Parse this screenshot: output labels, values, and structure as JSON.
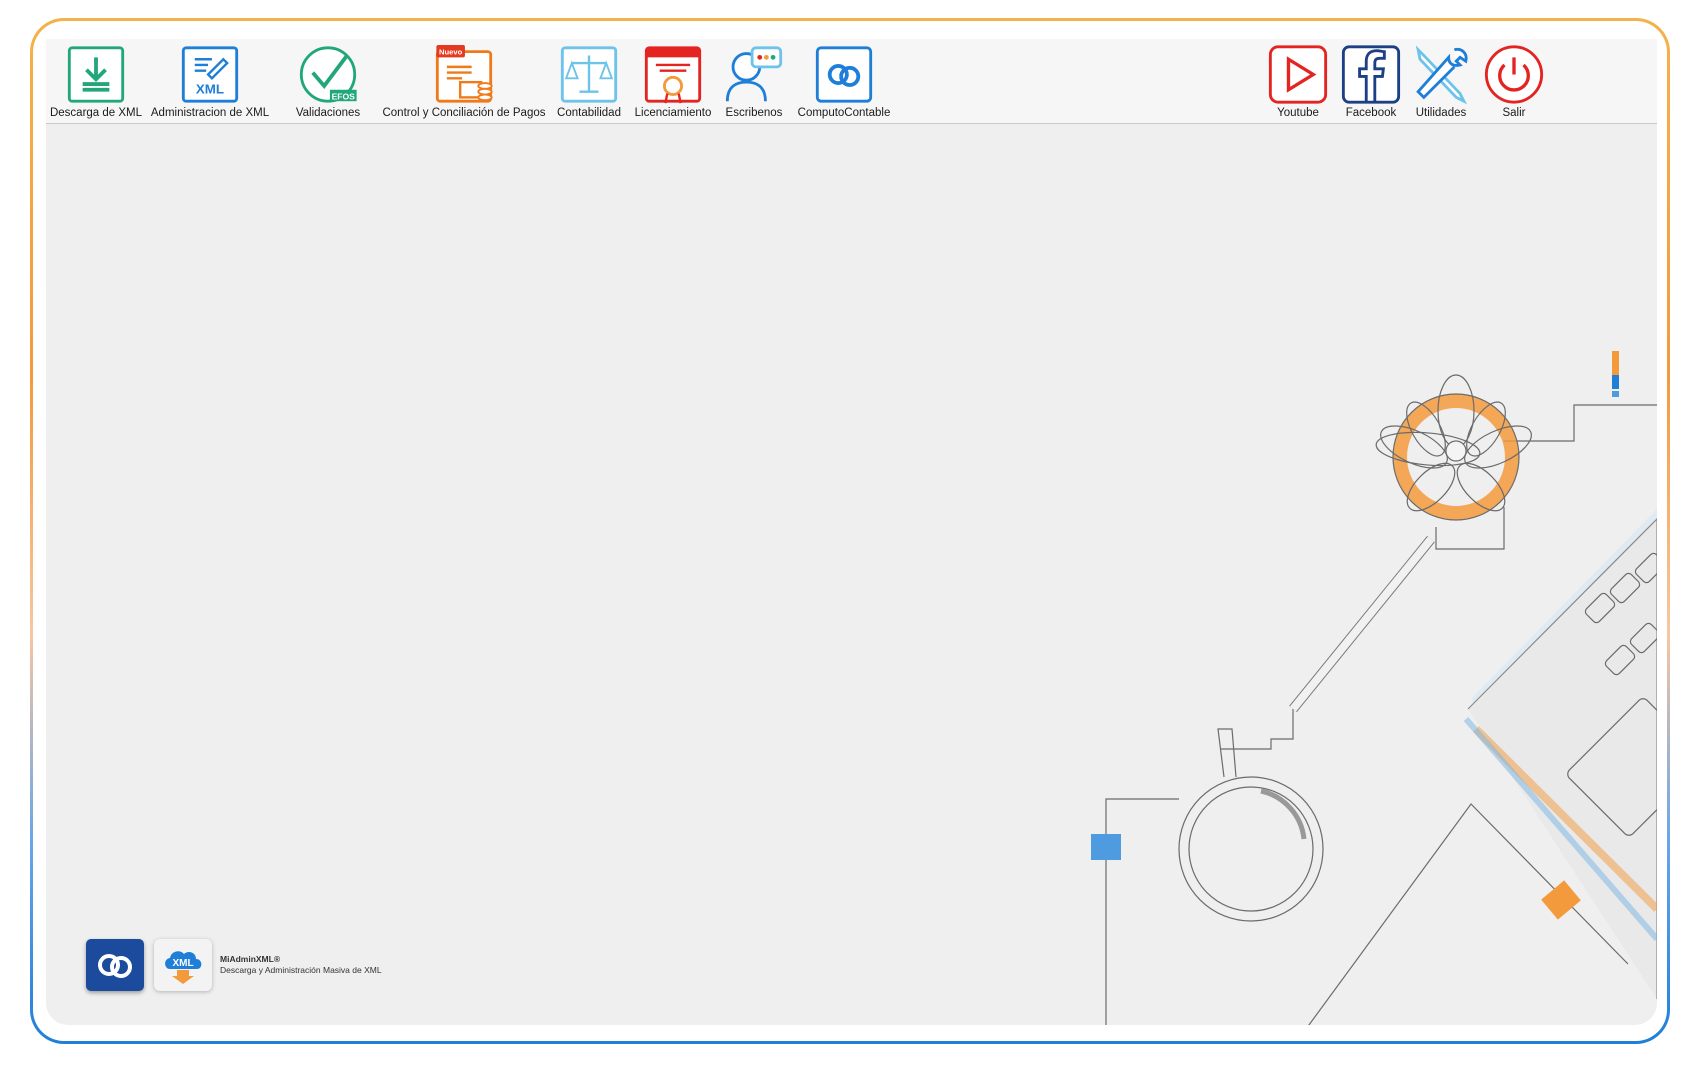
{
  "toolbar": {
    "items": [
      {
        "label": "Descarga de XML",
        "icon": "download-icon",
        "color": "#21a77a"
      },
      {
        "label": "Administracion de XML",
        "icon": "xml-edit-icon",
        "color": "#1f7fd8",
        "icon_text": "XML"
      },
      {
        "label": "Validaciones",
        "icon": "efos-check-icon",
        "color": "#21a77a",
        "icon_text": "EFOS"
      },
      {
        "label": "Control y Conciliación de Pagos",
        "icon": "payments-icon",
        "color": "#f07a1a",
        "badge": "Nuevo",
        "badge_color": "#e53a1f"
      },
      {
        "label": "Contabilidad",
        "icon": "scale-icon",
        "color": "#6ec3ea"
      },
      {
        "label": "Licenciamiento",
        "icon": "license-certificate-icon",
        "color": "#e32421"
      },
      {
        "label": "Escribenos",
        "icon": "chat-user-icon",
        "color": "#1f7fd8"
      },
      {
        "label": "ComputoContable",
        "icon": "computo-contable-icon",
        "color": "#1f7fd8"
      }
    ],
    "right_items": [
      {
        "label": "Youtube",
        "icon": "youtube-icon",
        "color": "#e32421"
      },
      {
        "label": "Facebook",
        "icon": "facebook-icon",
        "color": "#1c3f85"
      },
      {
        "label": "Utilidades",
        "icon": "tools-icon",
        "color": "#1f7fd8"
      },
      {
        "label": "Salir",
        "icon": "power-icon",
        "color": "#e32421"
      }
    ]
  },
  "brand": {
    "xml_logo_text": "XML",
    "name": "MiAdminXML®",
    "tagline": "Descarga y Administración Masiva de XML"
  },
  "colors": {
    "orange": "#f39a3c",
    "blue": "#1f7fd8",
    "background": "#efefef"
  }
}
